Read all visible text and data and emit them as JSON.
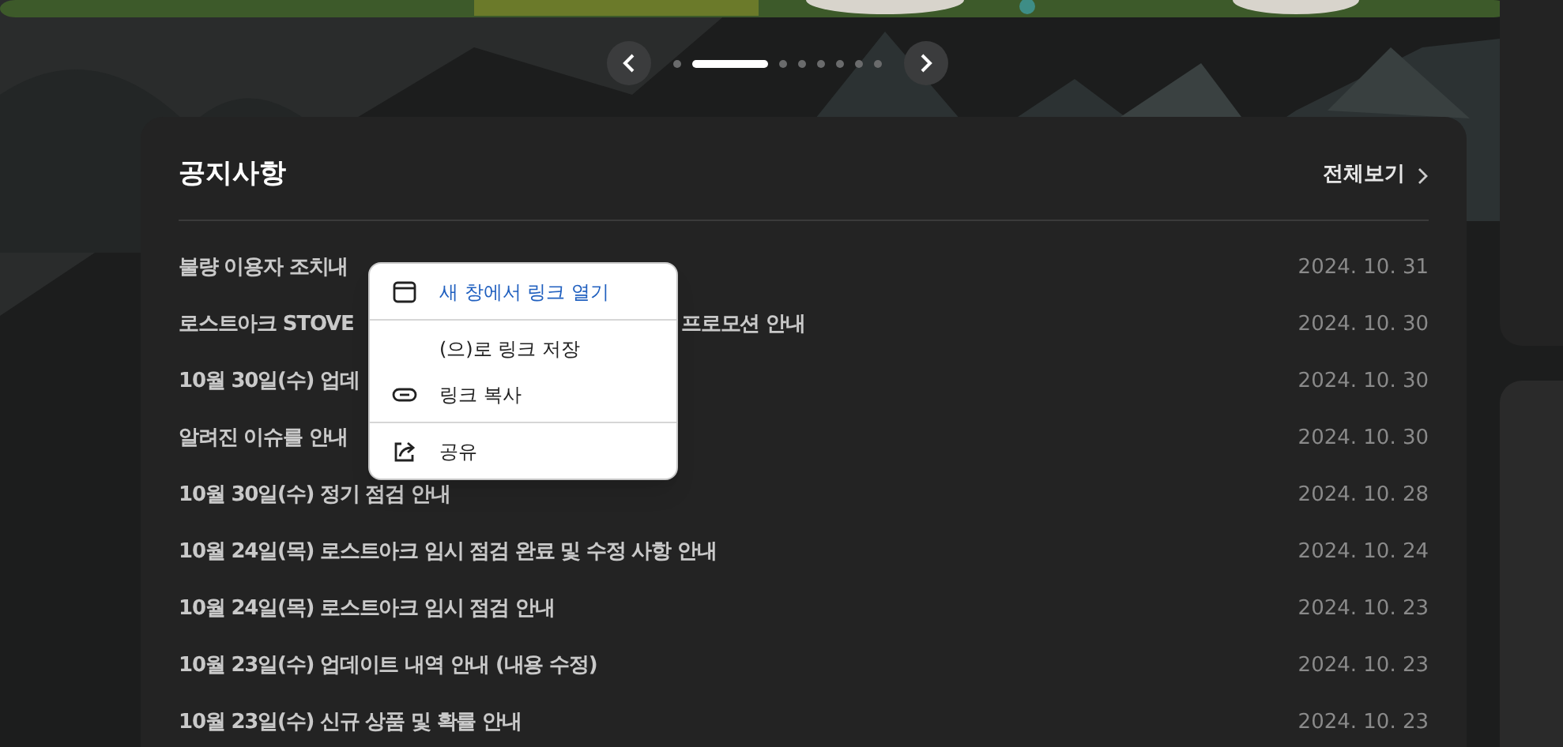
{
  "carousel": {
    "dots": [
      {
        "selected": false
      },
      {
        "selected": true
      },
      {
        "selected": false
      },
      {
        "selected": false
      },
      {
        "selected": false
      },
      {
        "selected": false
      },
      {
        "selected": false
      },
      {
        "selected": false
      }
    ]
  },
  "notice": {
    "title": "공지사항",
    "view_all": "전체보기",
    "rows": [
      {
        "title": "불량 이용자 조치내",
        "date": "2024. 10. 31"
      },
      {
        "title": "로스트아크 STOVE",
        "title_tail": "프로모션 안내",
        "date": "2024. 10. 30"
      },
      {
        "title": "10월 30일(수) 업데",
        "date": "2024. 10. 30"
      },
      {
        "title": "알려진 이슈를 안내",
        "date": "2024. 10. 30"
      },
      {
        "title": "10월 30일(수) 정기 점검 안내",
        "date": "2024. 10. 28"
      },
      {
        "title": "10월 24일(목) 로스트아크 임시 점검 완료 및 수정 사항 안내",
        "date": "2024. 10. 24"
      },
      {
        "title": "10월 24일(목) 로스트아크 임시 점검 안내",
        "date": "2024. 10. 23"
      },
      {
        "title": "10월 23일(수) 업데이트 내역 안내 (내용 수정)",
        "date": "2024. 10. 23"
      },
      {
        "title": "10월 23일(수) 신규 상품 및 확률 안내",
        "date": "2024. 10. 23"
      }
    ]
  },
  "context_menu": {
    "items": [
      {
        "kind": "window",
        "label": "새 창에서 링크 열기",
        "highlighted": true
      },
      {
        "kind": "divider"
      },
      {
        "kind": "plain",
        "label": "(으)로 링크 저장",
        "highlighted": false
      },
      {
        "kind": "link",
        "label": "링크 복사",
        "highlighted": false
      },
      {
        "kind": "divider"
      },
      {
        "kind": "share",
        "label": "공유",
        "highlighted": false
      }
    ]
  }
}
